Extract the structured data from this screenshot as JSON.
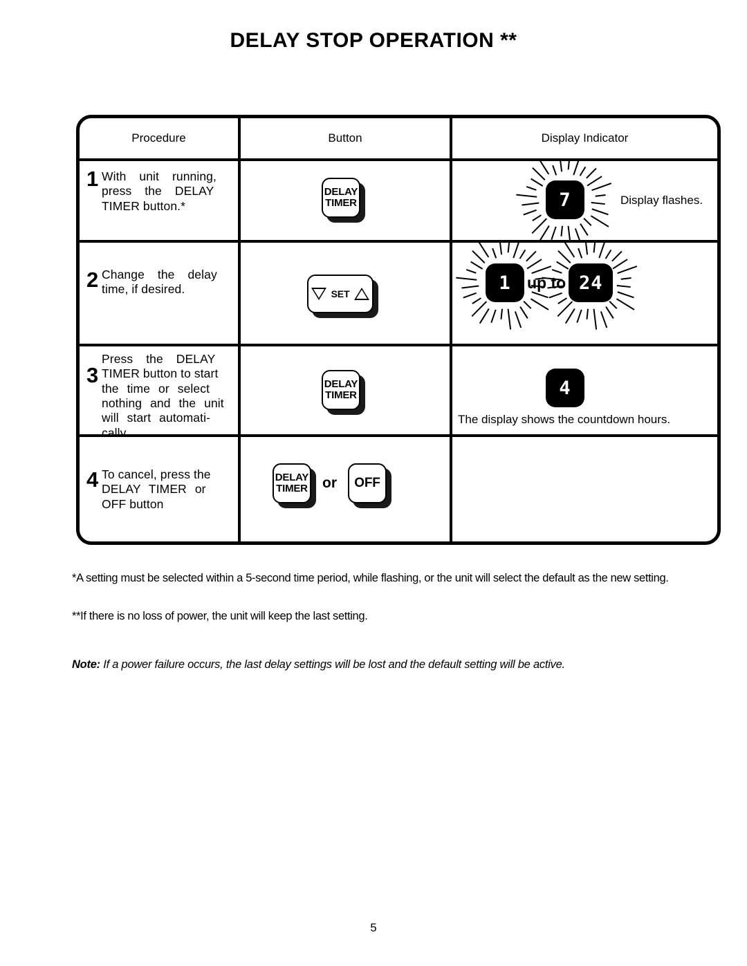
{
  "document": {
    "title": "DELAY STOP OPERATION **",
    "page_number": "5"
  },
  "table": {
    "headers": {
      "procedure": "Procedure",
      "button": "Button",
      "display_indicator": "Display Indicator"
    },
    "rows": [
      {
        "step": "1",
        "procedure_lines": [
          "With  unit  running,",
          "press  the  DELAY",
          "TIMER button.*"
        ],
        "button": {
          "type": "delay-timer-button",
          "label_line1": "DELAY",
          "label_line2": "TIMER"
        },
        "display": {
          "type": "flashing-led",
          "value": "7",
          "flashing": true,
          "caption": "Display flashes."
        }
      },
      {
        "step": "2",
        "procedure_lines": [
          "Change   the   delay",
          "time, if desired."
        ],
        "button": {
          "type": "set-button",
          "down_arrow": "down-triangle",
          "label": "SET",
          "up_arrow": "up-triangle"
        },
        "display": {
          "type": "flashing-led-range",
          "value_from": "1",
          "value_to": "24",
          "connector": "up to",
          "flashing": true,
          "caption": ""
        }
      },
      {
        "step": "3",
        "procedure_lines": [
          "Press   the   DELAY",
          "TIMER button to start",
          "the   time  or  select",
          "nothing  and  the  unit",
          "will   start  automati-",
          "cally."
        ],
        "button": {
          "type": "delay-timer-button",
          "label_line1": "DELAY",
          "label_line2": "TIMER"
        },
        "display": {
          "type": "led",
          "value": "4",
          "flashing": false,
          "caption": "The display shows the countdown hours."
        }
      },
      {
        "step": "4",
        "procedure_lines": [
          "To cancel, press the",
          "DELAY  TIMER  or",
          "OFF button"
        ],
        "button": {
          "type": "delay-timer-or-off-buttons",
          "label_line1": "DELAY",
          "label_line2": "TIMER",
          "connector": "or",
          "alt_label": "OFF"
        },
        "display": {
          "type": "none",
          "value": "",
          "caption": ""
        }
      }
    ]
  },
  "footnotes": {
    "asterisk": "*A setting must be selected within a 5-second time period, while flashing, or the unit will select the default as the new setting.",
    "double_asterisk": "**If there is no loss of power, the unit will keep the last setting."
  },
  "note": {
    "label": "Note:",
    "text": "If a power failure occurs, the last delay settings will be lost and the default setting will be active."
  }
}
